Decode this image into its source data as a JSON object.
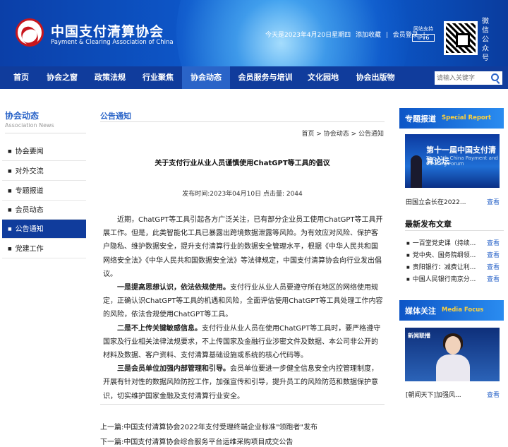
{
  "header": {
    "logo_cn": "中国支付清算协会",
    "logo_en": "Payment & Clearing Association of China",
    "date_text": "今天是2023年4月20日星期四",
    "add_favorite": "添加收藏",
    "separator": "|",
    "member_login": "会员登录",
    "ipv6_caption": "网站支持",
    "ipv6_label": "IPv6",
    "wechat_label": "微信公众号"
  },
  "nav": {
    "items": [
      "首页",
      "协会之窗",
      "政策法规",
      "行业聚焦",
      "协会动态",
      "会员服务与培训",
      "文化园地",
      "协会出版物"
    ],
    "active": "协会动态",
    "search_placeholder": "请输入关键字"
  },
  "sidebar": {
    "title": "协会动态",
    "subtitle": "Association News",
    "items": [
      "协会要闻",
      "对外交流",
      "专题报道",
      "会员动态",
      "公告通知",
      "党建工作"
    ],
    "active": "公告通知"
  },
  "main": {
    "section_title": "公告通知",
    "breadcrumb": "首页 > 协会动态 > 公告通知",
    "article_title": "关于支付行业从业人员谨慎使用ChatGPT等工具的倡议",
    "meta": "发布时间:2023年04月10日 点击量: 2044",
    "p1": "近期，ChatGPT等工具引起各方广泛关注，已有部分企业员工使用ChatGPT等工具开展工作。但是，此类智能化工具已暴露出跨境数据泄露等风险。为有效应对风险、保护客户隐私、维护数据安全，提升支付清算行业的数据安全管理水平，根据《中华人民共和国网络安全法》《中华人民共和国数据安全法》等法律规定，中国支付清算协会向行业发出倡议。",
    "p2_bold": "一是提高思想认识，依法依规使用。",
    "p2": "支付行业从业人员要遵守所在地区的网络使用规定，正确认识ChatGPT等工具的机遇和风险，全面评估使用ChatGPT等工具处理工作内容的风险，依法合规使用ChatGPT等工具。",
    "p3_bold": "二是不上传关键敏感信息。",
    "p3": "支付行业从业人员在使用ChatGPT等工具时，要严格遵守国家及行业相关法律法规要求，不上传国家及金融行业涉密文件及数据、本公司非公开的材料及数据、客户资料、支付清算基础设施或系统的核心代码等。",
    "p4_bold": "三是会员单位加强内部管理和引导。",
    "p4": "会员单位要进一步健全信息安全内控管理制度，开展有针对性的数据风险防控工作，加强宣传和引导，提升员工的风险防范和数据保护意识，切实维护国家金融及支付清算行业安全。",
    "prev": "上一篇:中国支付清算协会2022年支付受理终端企业标准\"领跑者\"发布",
    "next": "下一篇:中国支付清算协会综合服务平台运维采购项目成交公告"
  },
  "right": {
    "special": {
      "title_cn": "专题报道",
      "title_en": "Special Report",
      "photo_big": "第十一届中国支付清算论坛",
      "photo_small": "The 11th China Payment and Clearing Forum",
      "caption": "田国立会长在2022...",
      "view": "查看"
    },
    "latest": {
      "title": "最新发布文章",
      "items": [
        {
          "text": "一百堂党史课（持续...",
          "view": "查看"
        },
        {
          "text": "党中央、国务院纲领...",
          "view": "查看"
        },
        {
          "text": "贵阳银行：减费让利...",
          "view": "查看"
        },
        {
          "text": "中国人民银行南京分...",
          "view": "查看"
        }
      ]
    },
    "media": {
      "title_cn": "媒体关注",
      "title_en": "Media Focus",
      "photo_tag": "新闻联播",
      "caption": "[朝闻天下]加强风...",
      "view": "查看"
    }
  }
}
